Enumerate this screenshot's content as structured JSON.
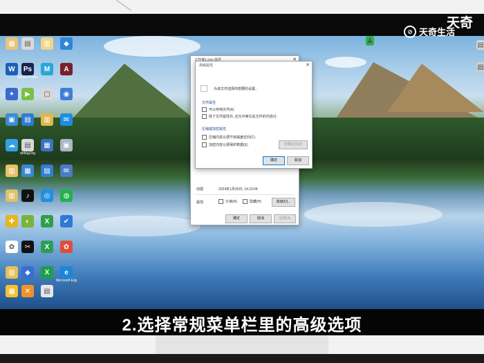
{
  "watermark": {
    "text_top": "天奇",
    "text_bottom": "天奇生活",
    "logo_glyph": "⊘"
  },
  "caption": "2.选择常规菜单栏里的高级选项",
  "desktop_icons": [
    {
      "label": "",
      "color": "#e9c47a",
      "glyph": "▦"
    },
    {
      "label": "",
      "color": "#d9d9d9",
      "glyph": "▤"
    },
    {
      "label": "",
      "color": "#f2d486",
      "glyph": "▥"
    },
    {
      "label": "",
      "color": "#2f86d8",
      "glyph": "◆"
    },
    {
      "label": "",
      "color": "#1e5fb4",
      "glyph": "W"
    },
    {
      "label": "Adobe Photoshop",
      "color": "#19234c",
      "glyph": "Ps"
    },
    {
      "label": "",
      "color": "#2aa7d8",
      "glyph": "M"
    },
    {
      "label": "",
      "color": "#7a1f2b",
      "glyph": "A"
    },
    {
      "label": "",
      "color": "#3a6ccc",
      "glyph": "✦"
    },
    {
      "label": "",
      "color": "#7ac043",
      "glyph": "▶"
    },
    {
      "label": "",
      "color": "#d8d8d8",
      "glyph": "▢"
    },
    {
      "label": "",
      "color": "#3f7ed6",
      "glyph": "◉"
    },
    {
      "label": "",
      "color": "#3a8ad9",
      "glyph": "▣"
    },
    {
      "label": "",
      "color": "#2e7bd3",
      "glyph": "▤"
    },
    {
      "label": "",
      "color": "#e2b64d",
      "glyph": "▥"
    },
    {
      "label": "",
      "color": "#1d8de3",
      "glyph": "✉"
    },
    {
      "label": "",
      "color": "#34a0e6",
      "glyph": "☁"
    },
    {
      "label": "debug.log",
      "color": "#d9d9d9",
      "glyph": "▤"
    },
    {
      "label": "",
      "color": "#3a72c4",
      "glyph": "▦"
    },
    {
      "label": "",
      "color": "#a9b9c8",
      "glyph": "▣"
    },
    {
      "label": "",
      "color": "#e8c16a",
      "glyph": "▥"
    },
    {
      "label": "",
      "color": "#3b86d4",
      "glyph": "▦"
    },
    {
      "label": "",
      "color": "#2f7fd2",
      "glyph": "▤"
    },
    {
      "label": "",
      "color": "#4a7bc5",
      "glyph": "✉"
    },
    {
      "label": "",
      "color": "#e2c06a",
      "glyph": "▥"
    },
    {
      "label": "",
      "color": "#111111",
      "glyph": "♪"
    },
    {
      "label": "",
      "color": "#1f8fe0",
      "glyph": "◎"
    },
    {
      "label": "",
      "color": "#23b14d",
      "glyph": "◍"
    },
    {
      "label": "",
      "color": "#e6b520",
      "glyph": "✚"
    },
    {
      "label": "",
      "color": "#7ab33a",
      "glyph": "◐"
    },
    {
      "label": "",
      "color": "#2f9e4d",
      "glyph": "X"
    },
    {
      "label": "",
      "color": "#2e79d6",
      "glyph": "✔"
    },
    {
      "label": "",
      "color": "#ffffff",
      "glyph": "✿"
    },
    {
      "label": "",
      "color": "#111111",
      "glyph": "✂"
    },
    {
      "label": "",
      "color": "#2d9e55",
      "glyph": "X"
    },
    {
      "label": "",
      "color": "#e14d3b",
      "glyph": "✿"
    },
    {
      "label": "",
      "color": "#e6c15a",
      "glyph": "▥"
    },
    {
      "label": "",
      "color": "#3a6ed0",
      "glyph": "◆"
    },
    {
      "label": "",
      "color": "#1d9e4d",
      "glyph": "X"
    },
    {
      "label": "Microsoft Edge",
      "color": "#1d86d6",
      "glyph": "e"
    },
    {
      "label": "",
      "color": "#f1c232",
      "glyph": "▦"
    },
    {
      "label": "",
      "color": "#f2912c",
      "glyph": "✕"
    },
    {
      "label": "",
      "color": "#e6e6e6",
      "glyph": "▤"
    }
  ],
  "right_edge_icons": [
    {
      "color": "#2bb14a",
      "glyph": "♟"
    },
    {
      "color": "#d8d8d8",
      "glyph": "▤"
    },
    {
      "color": "#d0d0d0",
      "glyph": "▤"
    }
  ],
  "properties_dialog": {
    "title": "工作簿1.xlsx 属性",
    "close_glyph": "✕",
    "field_row": {
      "label": "创建",
      "value": "2024年1月26日, 14:23:04"
    },
    "attributes_label": "属性:",
    "readonly_label": "只读(R)",
    "hidden_label": "隐藏(H)",
    "advanced_button": "高级(D)...",
    "ok_button": "确定",
    "cancel_button": "取消",
    "apply_button": "应用(A)"
  },
  "advanced_dialog": {
    "title": "高级属性",
    "close_glyph": "✕",
    "intro": "为该文件选择你想要的设置。",
    "file_attributes_heading": "文件属性",
    "archive_label": "可以存档文件(A)",
    "index_label": "除了文件属性外, 还允许索引此文件的内容(I)",
    "compress_heading": "压缩或加密属性",
    "compress_label": "压缩内容以便节省磁盘空间(C)",
    "encrypt_label": "加密内容以便保护数据(E)",
    "details_button": "详细信息(D)",
    "ok_button": "确定",
    "cancel_button": "取消"
  }
}
